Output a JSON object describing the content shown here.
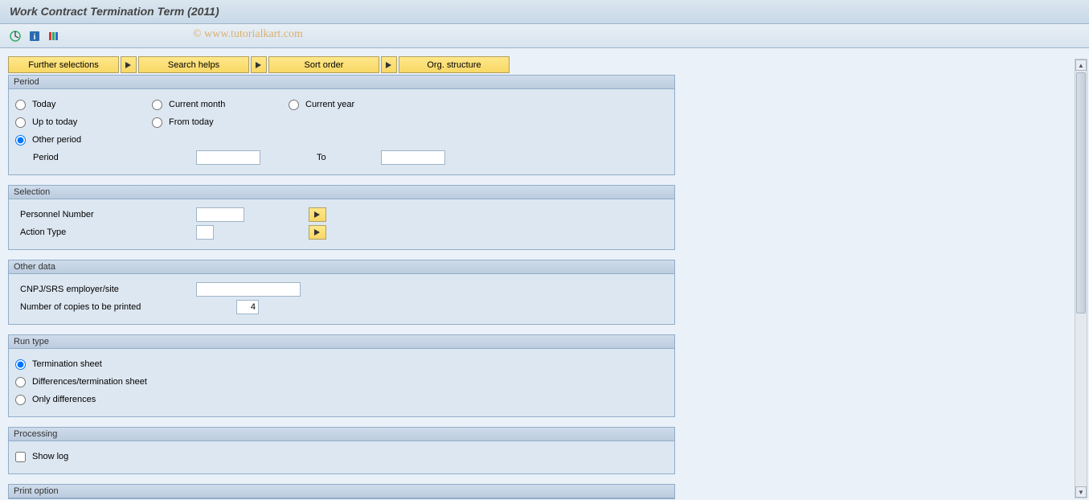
{
  "title": "Work Contract Termination Term (2011)",
  "watermark": "© www.tutorialkart.com",
  "toolbar_buttons": {
    "further_selections": "Further selections",
    "search_helps": "Search helps",
    "sort_order": "Sort order",
    "org_structure": "Org. structure"
  },
  "period": {
    "title": "Period",
    "today": "Today",
    "current_month": "Current month",
    "current_year": "Current year",
    "up_to_today": "Up to today",
    "from_today": "From today",
    "other_period": "Other period",
    "period_label": "Period",
    "to_label": "To",
    "period_from": "",
    "period_to": ""
  },
  "selection": {
    "title": "Selection",
    "personnel_number_label": "Personnel Number",
    "personnel_number_value": "",
    "action_type_label": "Action Type",
    "action_type_value": ""
  },
  "other_data": {
    "title": "Other data",
    "cnpj_label": "CNPJ/SRS employer/site",
    "cnpj_value": "",
    "copies_label": "Number of copies to be printed",
    "copies_value": "4"
  },
  "run_type": {
    "title": "Run type",
    "termination_sheet": "Termination sheet",
    "diff_termination": "Differences/termination sheet",
    "only_diff": "Only differences"
  },
  "processing": {
    "title": "Processing",
    "show_log": "Show log"
  },
  "print_option": {
    "title": "Print option"
  }
}
